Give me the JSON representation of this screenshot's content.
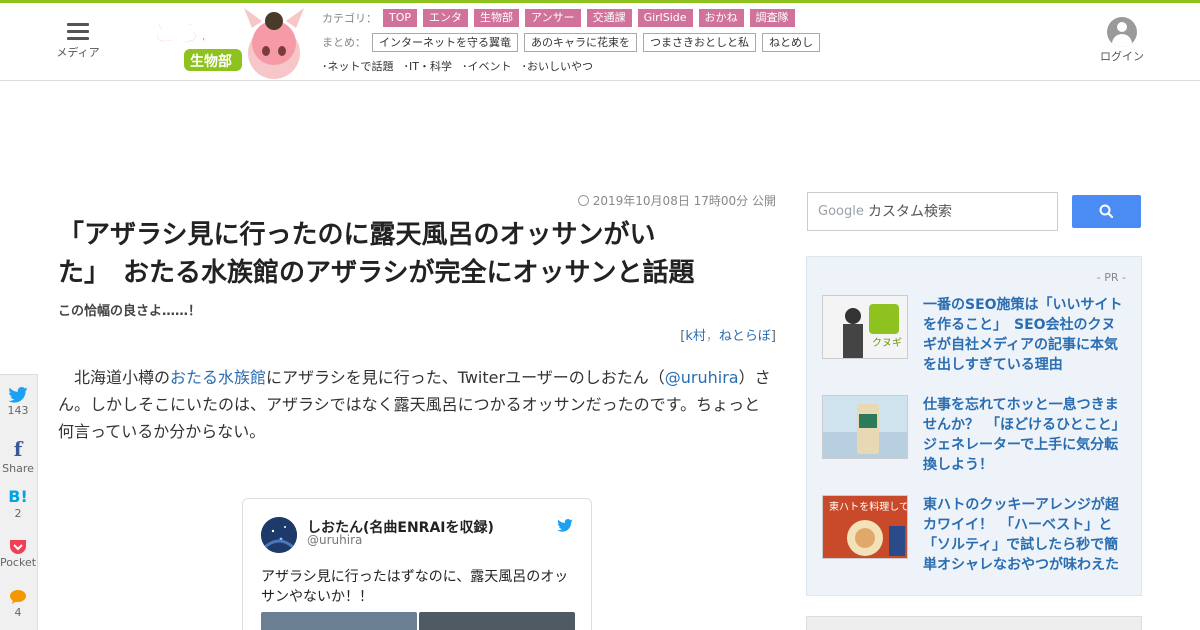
{
  "header": {
    "menu_label": "メディア",
    "logo_text": "ねとらぼ",
    "logo_sub": "生物部",
    "login_label": "ログイン",
    "category_label": "カテゴリ：",
    "categories": [
      "TOP",
      "エンタ",
      "生物部",
      "アンサー",
      "交通課",
      "GirlSide",
      "おかね",
      "調査隊"
    ],
    "matome_label": "まとめ：",
    "matome": [
      "インターネットを守る翼竜",
      "あのキャラに花束を",
      "つまさきおとしと私",
      "ねとめし"
    ],
    "topics": [
      "･ネットで話題",
      "･IT・科学",
      "･イベント",
      "･おいしいやつ"
    ]
  },
  "article": {
    "date": "2019年10月08日 17時00分 公開",
    "title_line1": "「アザラシ見に行ったのに露天風呂のオッサンがい",
    "title_line2": "た」　おたる水族館のアザラシが完全にオッサンと話題",
    "subtitle": "この恰幅の良さよ……！",
    "byline_open": "[",
    "byline_author": "k村",
    "byline_sep": "，",
    "byline_outlet": "ねとらぼ",
    "byline_close": "]",
    "body_p1": "　北海道小樽の",
    "body_link1": "おたる水族館",
    "body_p2": "にアザラシを見に行った、Twiterユーザーのしおたん（",
    "body_link2": "@uruhira",
    "body_p3": "）さん。しかしそこにいたのは、アザラシではなく露天風呂につかるオッサンだったのです。ちょっと何言っているか分からない。"
  },
  "share": {
    "twitter_count": "143",
    "facebook_label": "Share",
    "hatena_label": "B!",
    "hatena_count": "2",
    "pocket_label": "Pocket",
    "comment_count": "4"
  },
  "tweet": {
    "name": "しおたん(名曲ENRAIを収録)",
    "handle": "@uruhira",
    "text": "アザラシ見に行ったはずなのに、露天風呂のオッサンやないか！！"
  },
  "search": {
    "google_word": "Google",
    "placeholder": "カスタム検索"
  },
  "sidebar": {
    "pr_label": "- PR -",
    "pr_items": [
      {
        "title": "一番のSEO施策は「いいサイトを作ること」　SEO会社のクヌギが自社メディアの記事に本気を出しすぎている理由",
        "thumb_text": "クヌギ"
      },
      {
        "title": "仕事を忘れてホッと一息つきませんか？　「ほどけるひとこと」ジェネレーターで上手に気分転換しよう！",
        "thumb_text": ""
      },
      {
        "title": "東ハトのクッキーアレンジが超カワイイ！　「ハーベスト」と「ソルティ」で試したら秒で簡単オシャレなおやつが味わえた",
        "thumb_text": "東ハトを料理してみた"
      }
    ]
  },
  "colors": {
    "accent_green": "#8dc21f",
    "category_pink": "#d0729a",
    "link_blue": "#2a6db0",
    "search_blue": "#4b8bf4"
  }
}
